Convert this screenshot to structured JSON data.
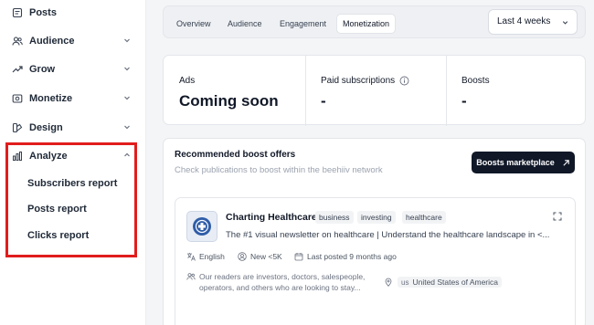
{
  "sidebar": {
    "items": [
      {
        "label": "Posts",
        "icon": "posts-icon",
        "expandable": false
      },
      {
        "label": "Audience",
        "icon": "audience-icon",
        "expandable": true
      },
      {
        "label": "Grow",
        "icon": "grow-icon",
        "expandable": true
      },
      {
        "label": "Monetize",
        "icon": "monetize-icon",
        "expandable": true
      },
      {
        "label": "Design",
        "icon": "design-icon",
        "expandable": true
      },
      {
        "label": "Analyze",
        "icon": "analyze-icon",
        "expandable": true,
        "expanded": true
      }
    ],
    "analyze_children": [
      "Subscribers report",
      "Posts report",
      "Clicks report"
    ],
    "highlight_color": "#e11d1d"
  },
  "tabs": [
    {
      "label": "Overview",
      "active": false
    },
    {
      "label": "Audience",
      "active": false
    },
    {
      "label": "Engagement",
      "active": false
    },
    {
      "label": "Monetization",
      "active": true
    }
  ],
  "date_range": {
    "selected": "Last 4 weeks"
  },
  "stats": [
    {
      "label": "Ads",
      "value": "Coming soon"
    },
    {
      "label": "Paid subscriptions",
      "value": "-",
      "info_icon": true
    },
    {
      "label": "Boosts",
      "value": "-"
    }
  ],
  "boosts": {
    "title": "Recommended boost offers",
    "subtitle": "Check publications to boost within the beehiiv network",
    "marketplace_button": "Boosts marketplace",
    "offer": {
      "name": "Charting Healthcare",
      "tags": [
        "business",
        "investing",
        "healthcare"
      ],
      "description": "The #1 visual newsletter on healthcare | Understand the healthcare landscape in <...",
      "language": "English",
      "size": "New <5K",
      "last_posted": "Last posted 9 months ago",
      "audience_line1": "Our readers are investors, doctors, salespeople,",
      "audience_line2": "operators, and others who are looking to stay...",
      "country_code": "us",
      "country": "United States of America"
    }
  },
  "colors": {
    "button_dark": "#101828",
    "main_bg": "#f4f5f7"
  }
}
